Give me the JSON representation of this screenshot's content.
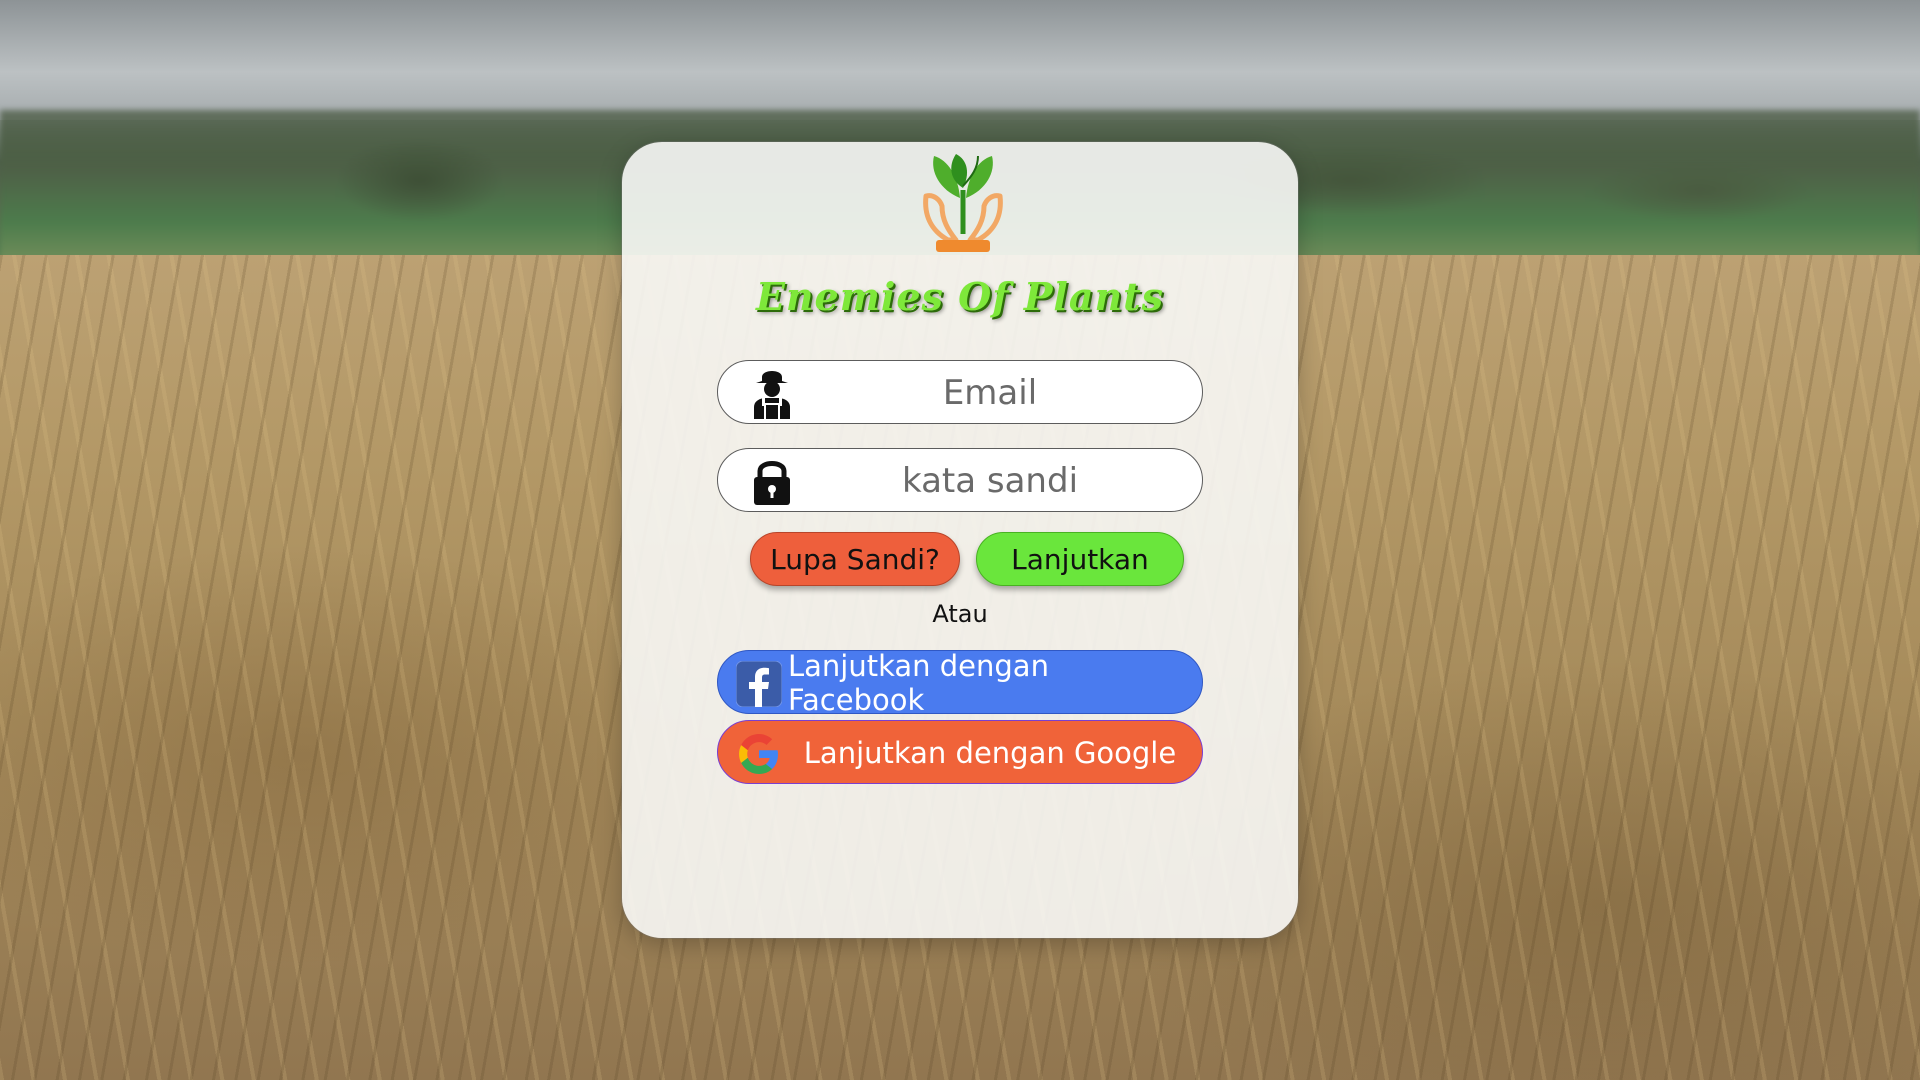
{
  "app": {
    "title": "Enemies Of Plants",
    "logo_icon": "sprout-in-hands-icon"
  },
  "login": {
    "email": {
      "placeholder": "Email",
      "value": "",
      "icon": "farmer-icon"
    },
    "password": {
      "placeholder": "kata sandi",
      "value": "",
      "icon": "padlock-icon"
    },
    "forgot_label": "Lupa Sandi?",
    "continue_label": "Lanjutkan",
    "separator": "Atau"
  },
  "social": {
    "facebook_label": "Lanjutkan dengan Facebook",
    "facebook_icon": "facebook-icon",
    "google_label": "Lanjutkan dengan Google",
    "google_icon": "google-icon"
  },
  "colors": {
    "title": "#7ee83a",
    "forgot_button": "#ee5f3c",
    "continue_button": "#6ae63c",
    "facebook_button": "#4a7bef",
    "google_button": "#f06339"
  }
}
